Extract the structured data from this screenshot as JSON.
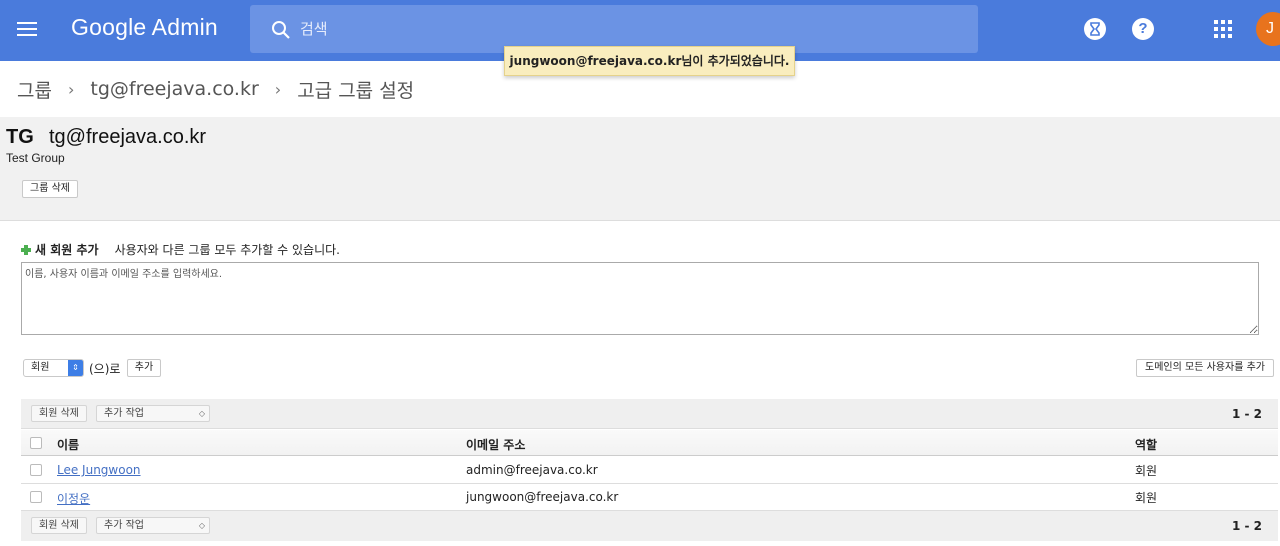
{
  "appbar": {
    "brand": "Google Admin",
    "search_placeholder": "검색",
    "help_label": "?",
    "avatar_initial": "J"
  },
  "toast": {
    "message": "jungwoon@freejava.co.kr님이 추가되었습니다."
  },
  "breadcrumb": {
    "items": [
      "그룹",
      "tg@freejava.co.kr",
      "고급 그룹 설정"
    ],
    "separator": "›"
  },
  "group": {
    "code": "TG",
    "email": "tg@freejava.co.kr",
    "name": "Test Group",
    "delete_label": "그룹 삭제"
  },
  "add_member": {
    "title": "새 회원 추가",
    "hint": "사용자와 다른 그룹 모두 추가할 수 있습니다.",
    "textarea_placeholder": "이름, 사용자 이름과 이메일 주소를 입력하세요.",
    "role_selected": "회원",
    "as_text": "(으)로",
    "add_label": "추가",
    "add_all_label": "도메인의 모든 사용자를 추가"
  },
  "table": {
    "toolbar": {
      "delete_label": "회원 삭제",
      "more_label": "추가 작업",
      "range": "1 - 2"
    },
    "columns": [
      "이름",
      "이메일 주소",
      "역할"
    ],
    "rows": [
      {
        "name": "Lee Jungwoon",
        "email": "admin@freejava.co.kr",
        "role": "회원"
      },
      {
        "name": "이정운",
        "email": "jungwoon@freejava.co.kr",
        "role": "회원"
      }
    ]
  },
  "colors": {
    "appbar": "#4a7bdc",
    "avatar": "#e8731d",
    "toast_bg": "#f9edbe",
    "link": "#4470c4"
  }
}
